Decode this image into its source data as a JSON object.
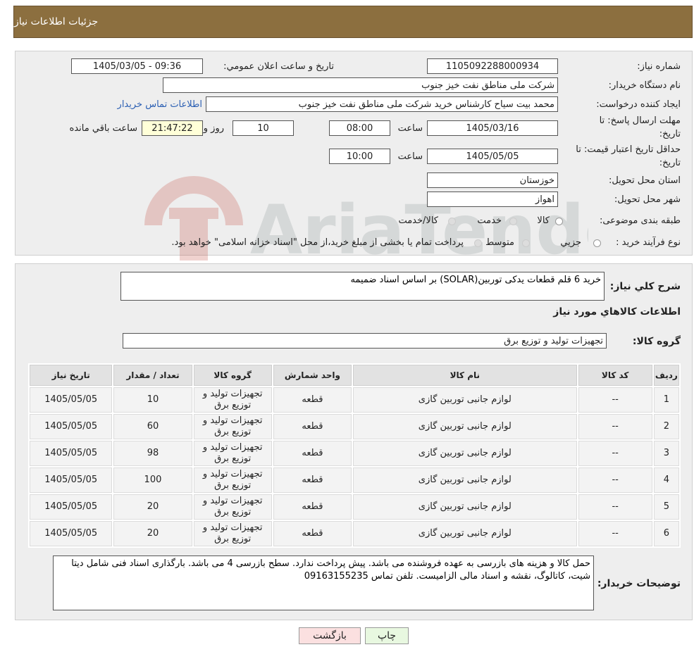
{
  "page_title": "جزئیات اطلاعات نیاز",
  "fields": {
    "need_number_label": "شماره نیاز:",
    "need_number": "1105092288000934",
    "announce_label": "تاریخ و ساعت اعلان عمومي:",
    "announce_value": "1405/03/05 - 09:36",
    "buyer_org_label": "نام دستگاه خریدار:",
    "buyer_org": "شرکت ملی مناطق نفت خیز جنوب",
    "creator_label": "ایجاد کننده درخواست:",
    "creator": "محمد بیت سیاح کارشناس خرید شرکت ملی مناطق نفت خیز جنوب",
    "contact_link": "اطلاعات تماس خریدار",
    "deadline_label_1": "مهلت ارسال پاسخ: تا",
    "deadline_label_2": "تاریخ:",
    "deadline_date": "1405/03/16",
    "time_label": "ساعت",
    "deadline_time": "08:00",
    "days_value": "10",
    "days_label": "روز و",
    "remaining_time": "21:47:22",
    "remaining_label": "ساعت باقي مانده",
    "validity_label_1": "حداقل تاریخ اعتبار قیمت: تا",
    "validity_label_2": "تاریخ:",
    "validity_date": "1405/05/05",
    "validity_time": "10:00",
    "province_label": "استان محل تحویل:",
    "province": "خوزستان",
    "city_label": "شهر محل تحویل:",
    "city": "اهواز",
    "category_label": "طبقه بندی موضوعی:",
    "cat_goods": "کالا",
    "cat_service": "خدمت",
    "cat_both": "کالا/خدمت",
    "process_label": "نوع فرآیند خرید :",
    "proc_small": "جزیي",
    "proc_medium": "متوسط",
    "proc_note": "پرداخت تمام یا بخشی از مبلغ خرید،از محل \"اسناد خزانه اسلامی\" خواهد بود."
  },
  "description": {
    "label": "شرح کلي نیاز:",
    "value": "خرید 6 قلم قطعات یدکی توربین(SOLAR) بر اساس اسناد ضمیمه"
  },
  "goods_info_title": "اطلاعات کالاهاي مورد نیاز",
  "goods_group": {
    "label": "گروه کالا:",
    "value": "تجهیزات تولید و توزیع برق"
  },
  "table": {
    "headers": [
      "ردیف",
      "کد کالا",
      "نام کالا",
      "واحد شمارش",
      "گروه کالا",
      "تعداد / مقدار",
      "تاریخ نیاز"
    ],
    "rows": [
      [
        "1",
        "--",
        "لوازم جانبی توربین گازی",
        "قطعه",
        "تجهیزات تولید و توزیع برق",
        "10",
        "1405/05/05"
      ],
      [
        "2",
        "--",
        "لوازم جانبی توربین گازی",
        "قطعه",
        "تجهیزات تولید و توزیع برق",
        "60",
        "1405/05/05"
      ],
      [
        "3",
        "--",
        "لوازم جانبی توربین گازی",
        "قطعه",
        "تجهیزات تولید و توزیع برق",
        "98",
        "1405/05/05"
      ],
      [
        "4",
        "--",
        "لوازم جانبی توربین گازی",
        "قطعه",
        "تجهیزات تولید و توزیع برق",
        "100",
        "1405/05/05"
      ],
      [
        "5",
        "--",
        "لوازم جانبی توربین گازی",
        "قطعه",
        "تجهیزات تولید و توزیع برق",
        "20",
        "1405/05/05"
      ],
      [
        "6",
        "--",
        "لوازم جانبی توربین گازی",
        "قطعه",
        "تجهیزات تولید و توزیع برق",
        "20",
        "1405/05/05"
      ]
    ]
  },
  "buyer_notes": {
    "label": "توضیحات خریدار:",
    "value": "حمل کالا و هزینه های بازرسی به عهده فروشنده می باشد. پیش پرداخت ندارد. سطح بازرسی 4 می باشد. بارگذاری اسناد فنی شامل دیتا شیت، کاتالوگ، نقشه و اسناد مالی الزامیست. تلفن تماس 09163155235"
  },
  "buttons": {
    "print": "چاپ",
    "back": "بازگشت"
  },
  "watermark_text": "AriaTender.neT",
  "colors": {
    "header": "#8c6f3f",
    "panel": "#eeeeee",
    "link": "#2b5fb3",
    "print_btn": "#e8f8e0",
    "back_btn": "#fbe0e0"
  }
}
